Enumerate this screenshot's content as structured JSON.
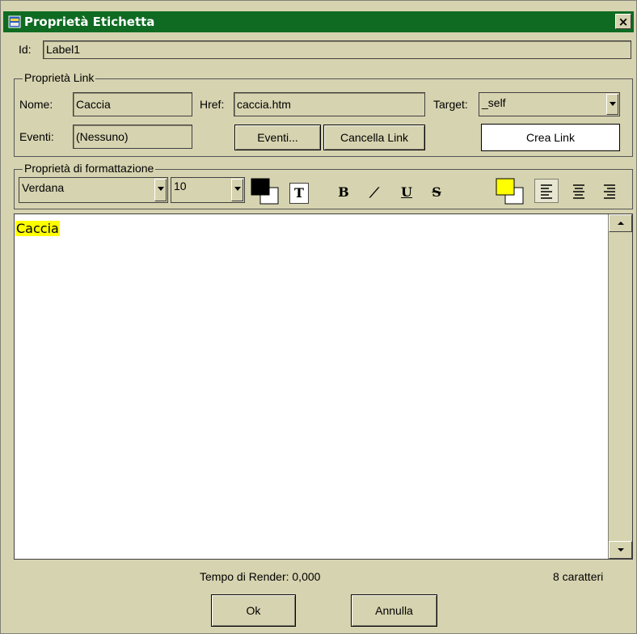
{
  "window": {
    "title": "Proprietà Etichetta",
    "close_glyph": "×"
  },
  "id_row": {
    "label": "Id:",
    "value": "Label1"
  },
  "link_group": {
    "legend": "Proprietà Link",
    "nome_label": "Nome:",
    "nome_value": "Caccia",
    "href_label": "Href:",
    "href_value": "caccia.htm",
    "target_label": "Target:",
    "target_value": "_self",
    "eventi_label": "Eventi:",
    "eventi_value": "(Nessuno)",
    "eventi_button": "Eventi...",
    "cancella_button": "Cancella Link",
    "crea_button": "Crea Link"
  },
  "format_group": {
    "legend": "Proprietà di formattazione",
    "font_value": "Verdana",
    "size_value": "10",
    "text_color": "#000000",
    "highlight_color": "#ffff00",
    "bold_glyph": "B",
    "italic_glyph": "/",
    "underline_glyph": "U",
    "strike_glyph": "S",
    "text_icon_glyph": "T"
  },
  "editor": {
    "content": "Caccia"
  },
  "status": {
    "render_time": "Tempo di Render: 0,000",
    "char_count": "8 caratteri"
  },
  "buttons": {
    "ok": "Ok",
    "cancel": "Annulla"
  }
}
